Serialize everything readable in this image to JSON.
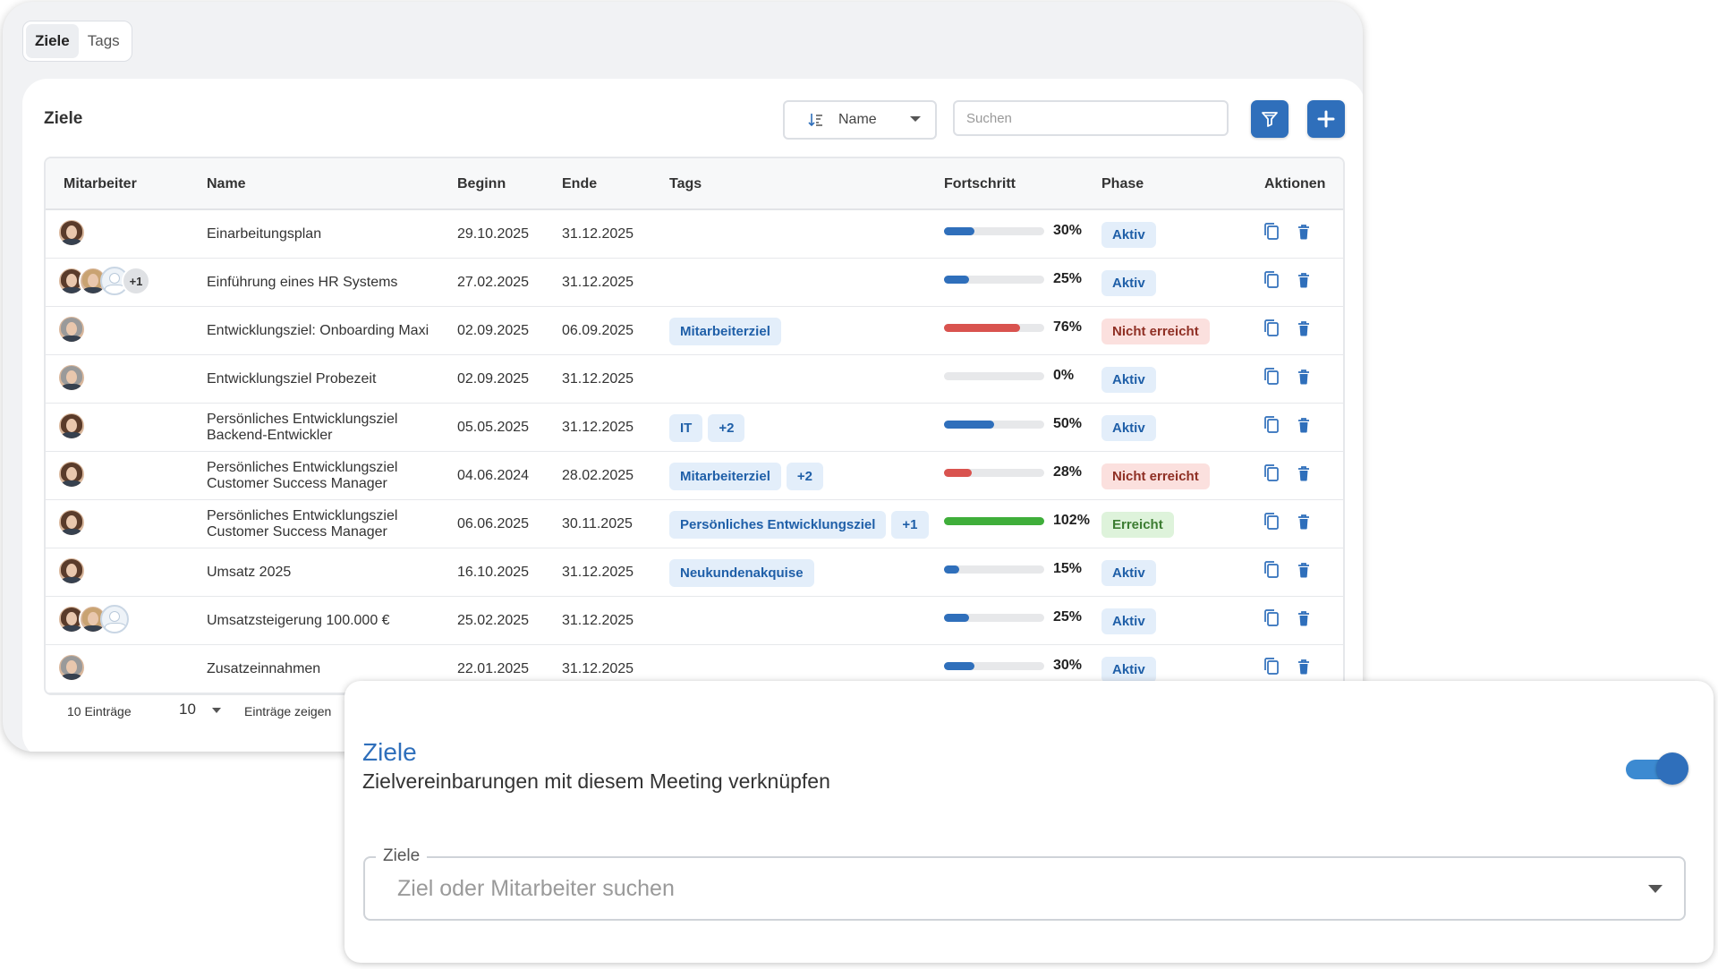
{
  "tabs": [
    {
      "label": "Ziele",
      "active": true
    },
    {
      "label": "Tags",
      "active": false
    }
  ],
  "panel": {
    "title": "Ziele",
    "sort": {
      "label": "Name"
    },
    "search": {
      "placeholder": "Suchen"
    },
    "filter_icon": "filter-icon",
    "add_icon": "plus-icon"
  },
  "table": {
    "headers": [
      "Mitarbeiter",
      "Name",
      "Beginn",
      "Ende",
      "Tags",
      "Fortschritt",
      "Phase",
      "Aktionen"
    ],
    "rows": [
      {
        "avatars": [
          "dark"
        ],
        "avatar_more": "",
        "name": "Einarbeitungsplan",
        "name2": "",
        "begin": "29.10.2025",
        "end": "31.12.2025",
        "tags": [],
        "progress": 30,
        "progress_label": "30%",
        "progress_color": "#2f6fbb",
        "phase": "Aktiv",
        "phase_style": "blue"
      },
      {
        "avatars": [
          "dark",
          "light",
          "empty"
        ],
        "avatar_more": "+1",
        "name": "Einführung eines HR Systems",
        "name2": "",
        "begin": "27.02.2025",
        "end": "31.12.2025",
        "tags": [],
        "progress": 25,
        "progress_label": "25%",
        "progress_color": "#2f6fbb",
        "phase": "Aktiv",
        "phase_style": "blue"
      },
      {
        "avatars": [
          "grey"
        ],
        "avatar_more": "",
        "name": "Entwicklungsziel: Onboarding Maxi",
        "name2": "",
        "begin": "02.09.2025",
        "end": "06.09.2025",
        "tags": [
          "Mitarbeiterziel"
        ],
        "progress": 76,
        "progress_label": "76%",
        "progress_color": "#d9534f",
        "phase": "Nicht erreicht",
        "phase_style": "red"
      },
      {
        "avatars": [
          "grey"
        ],
        "avatar_more": "",
        "name": "Entwicklungsziel Probezeit",
        "name2": "",
        "begin": "02.09.2025",
        "end": "31.12.2025",
        "tags": [],
        "progress": 0,
        "progress_label": "0%",
        "progress_color": "#2f6fbb",
        "phase": "Aktiv",
        "phase_style": "blue"
      },
      {
        "avatars": [
          "dark"
        ],
        "avatar_more": "",
        "name": "Persönliches Entwicklungsziel",
        "name2": "Backend-Entwickler",
        "begin": "05.05.2025",
        "end": "31.12.2025",
        "tags": [
          "IT",
          "+2"
        ],
        "progress": 50,
        "progress_label": "50%",
        "progress_color": "#2f6fbb",
        "phase": "Aktiv",
        "phase_style": "blue"
      },
      {
        "avatars": [
          "dark"
        ],
        "avatar_more": "",
        "name": "Persönliches Entwicklungsziel",
        "name2": "Customer Success Manager",
        "begin": "04.06.2024",
        "end": "28.02.2025",
        "tags": [
          "Mitarbeiterziel",
          "+2"
        ],
        "progress": 28,
        "progress_label": "28%",
        "progress_color": "#d9534f",
        "phase": "Nicht erreicht",
        "phase_style": "red"
      },
      {
        "avatars": [
          "dark"
        ],
        "avatar_more": "",
        "name": "Persönliches Entwicklungsziel",
        "name2": "Customer Success Manager",
        "begin": "06.06.2025",
        "end": "30.11.2025",
        "tags": [
          "Persönliches Entwicklungsziel",
          "+1"
        ],
        "progress": 100,
        "progress_label": "102%",
        "progress_color": "#3fae3a",
        "phase": "Erreicht",
        "phase_style": "green"
      },
      {
        "avatars": [
          "dark"
        ],
        "avatar_more": "",
        "name": "Umsatz 2025",
        "name2": "",
        "begin": "16.10.2025",
        "end": "31.12.2025",
        "tags": [
          "Neukundenakquise"
        ],
        "progress": 15,
        "progress_label": "15%",
        "progress_color": "#2f6fbb",
        "phase": "Aktiv",
        "phase_style": "blue"
      },
      {
        "avatars": [
          "dark",
          "light",
          "empty"
        ],
        "avatar_more": "",
        "name": "Umsatzsteigerung 100.000 €",
        "name2": "",
        "begin": "25.02.2025",
        "end": "31.12.2025",
        "tags": [],
        "progress": 25,
        "progress_label": "25%",
        "progress_color": "#2f6fbb",
        "phase": "Aktiv",
        "phase_style": "blue"
      },
      {
        "avatars": [
          "grey"
        ],
        "avatar_more": "",
        "name": "Zusatzeinnahmen",
        "name2": "",
        "begin": "22.01.2025",
        "end": "31.12.2025",
        "tags": [],
        "progress": 30,
        "progress_label": "30%",
        "progress_color": "#2f6fbb",
        "phase": "Aktiv",
        "phase_style": "blue"
      }
    ],
    "action_icons": [
      "copy-icon",
      "trash-icon"
    ]
  },
  "footer": {
    "entries_label": "10 Einträge",
    "page_size": "10",
    "show_label": "Einträge zeigen"
  },
  "overlay": {
    "title": "Ziele",
    "subtitle": "Zielvereinbarungen mit diesem Meeting verknüpfen",
    "toggle_on": true,
    "field_label": "Ziele",
    "field_placeholder": "Ziel oder Mitarbeiter   suchen"
  },
  "colors": {
    "accent": "#2f6fbb",
    "danger": "#d9534f",
    "success": "#3fae3a"
  }
}
